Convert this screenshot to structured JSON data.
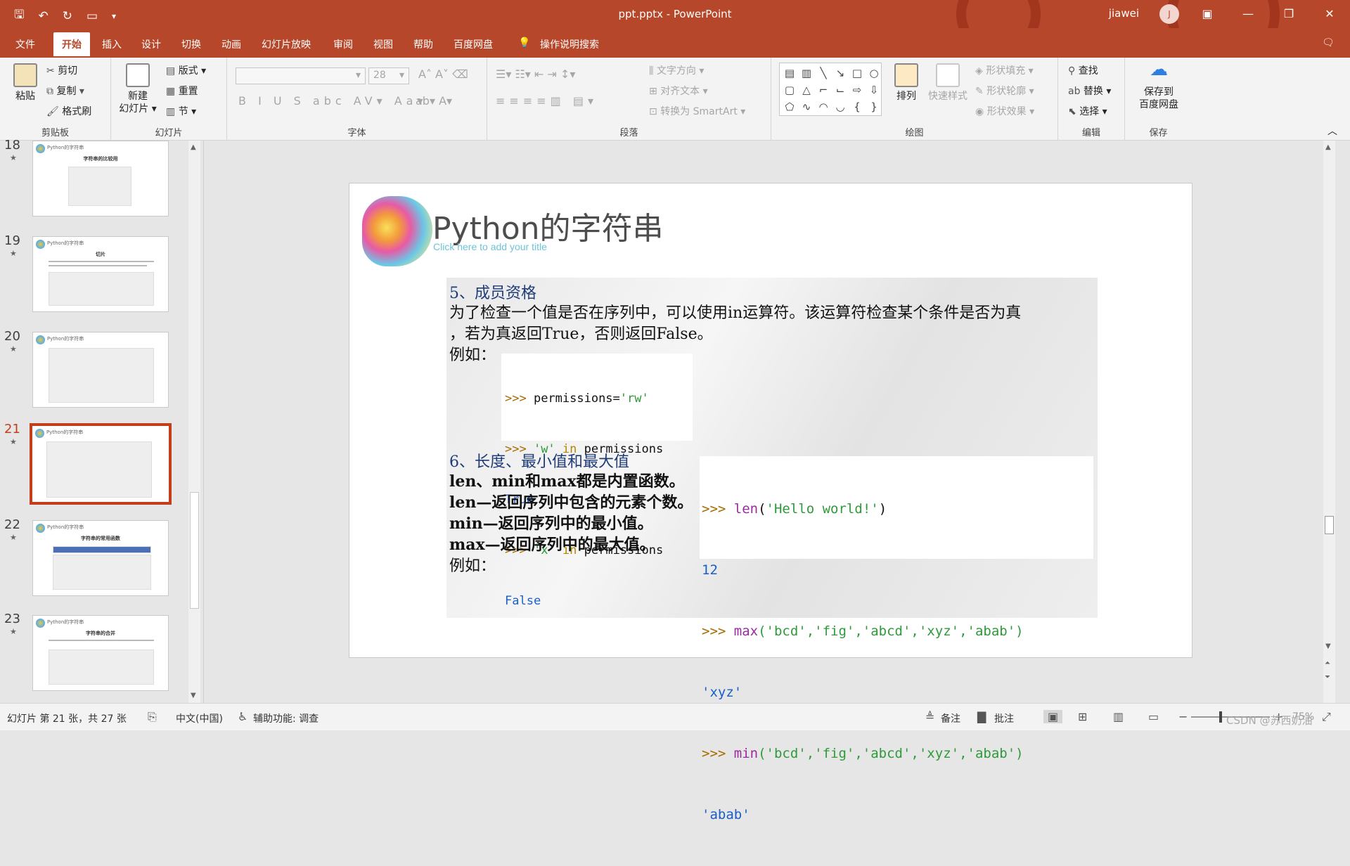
{
  "window": {
    "title": "ppt.pptx  -  PowerPoint",
    "user": "jiawei",
    "avatar_letter": "J"
  },
  "menu": [
    "文件",
    "开始",
    "插入",
    "设计",
    "切换",
    "动画",
    "幻灯片放映",
    "审阅",
    "视图",
    "帮助",
    "百度网盘"
  ],
  "menu_active_index": 1,
  "tell_me": "操作说明搜索",
  "ribbon": {
    "clipboard": {
      "label": "剪贴板",
      "paste": "粘贴",
      "cut": "剪切",
      "copy": "复制",
      "format_painter": "格式刷"
    },
    "slides": {
      "label": "幻灯片",
      "new_slide_1": "新建",
      "new_slide_2": "幻灯片",
      "layout": "版式",
      "reset": "重置",
      "section": "节"
    },
    "font": {
      "label": "字体",
      "size": "28"
    },
    "paragraph": {
      "label": "段落",
      "text_direction": "文字方向",
      "align_text": "对齐文本",
      "smartart": "转换为 SmartArt"
    },
    "drawing": {
      "label": "绘图",
      "arrange": "排列",
      "quick_styles": "快速样式",
      "fill": "形状填充",
      "outline": "形状轮廓",
      "effects": "形状效果"
    },
    "editing": {
      "label": "编辑",
      "find": "查找",
      "replace": "替换",
      "select": "选择"
    },
    "save": {
      "label": "保存",
      "save_to_1": "保存到",
      "save_to_2": "百度网盘"
    }
  },
  "thumbnails": [
    {
      "num": "18",
      "sub": "字符串的比较用"
    },
    {
      "num": "19",
      "sub": "切片"
    },
    {
      "num": "20",
      "sub": ""
    },
    {
      "num": "21",
      "sub": ""
    },
    {
      "num": "22",
      "sub": "字符串的常用函数"
    },
    {
      "num": "23",
      "sub": "字符串的合并"
    }
  ],
  "thumb_header": "Python的字符串",
  "selected_slide": "21",
  "slide": {
    "title": "Python的字符串",
    "subtitle": "Click here to add your title",
    "sec5_heading": "5、成员资格",
    "sec5_line1": "为了检查一个值是否在序列中，可以使用in运算符。该运算符检查某个条件是否为真",
    "sec5_line2": "，若为真返回True，否则返回False。",
    "sec5_example": "例如：",
    "code1": {
      "l1_prompt": ">>> ",
      "l1_a": "permissions=",
      "l1_b": "'rw'",
      "l2_prompt": ">>> ",
      "l2_a": "'w'",
      "l2_b": " in ",
      "l2_c": "permissions",
      "l3": "True",
      "l4_prompt": ">>> ",
      "l4_a": "'x'",
      "l4_b": " in ",
      "l4_c": "permissions",
      "l5": "False"
    },
    "sec6_heading": "6、长度、最小值和最大值",
    "sec6_line1": "len、min和max都是内置函数。",
    "sec6_line2": "len—返回序列中包含的元素个数。",
    "sec6_line3": "min—返回序列中的最小值。",
    "sec6_line4": "max—返回序列中的最大值。",
    "sec6_example": "例如：",
    "code2": {
      "l1_prompt": ">>> ",
      "l1_fn": "len",
      "l1_p1": "(",
      "l1_s": "'Hello world!'",
      "l1_p2": ")",
      "l2": "12",
      "l3_prompt": ">>> ",
      "l3_fn": "max",
      "l3_args": "('bcd','fig','abcd','xyz','abab')",
      "l4": "'xyz'",
      "l5_prompt": ">>> ",
      "l5_fn": "min",
      "l5_args": "('bcd','fig','abcd','xyz','abab')",
      "l6": "'abab'"
    }
  },
  "status": {
    "slide_info": "幻灯片 第 21 张，共 27 张",
    "language": "中文(中国)",
    "accessibility": "辅助功能: 调查",
    "notes": "备注",
    "comments": "批注",
    "zoom": "75%",
    "watermark": "CSDN @苏西奶油"
  },
  "colors": {
    "accent": "#b7472a",
    "selected": "#c43e1c"
  }
}
